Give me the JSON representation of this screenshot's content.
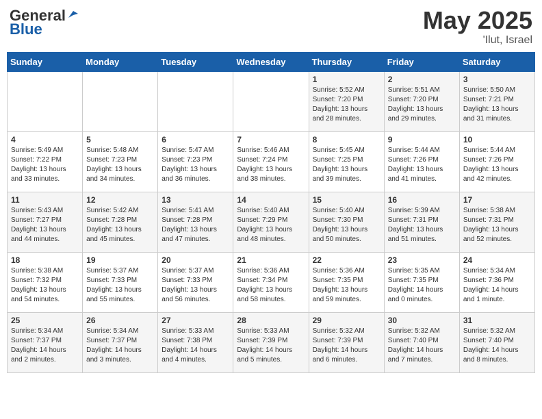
{
  "header": {
    "logo_general": "General",
    "logo_blue": "Blue",
    "month_year": "May 2025",
    "location": "'Ilut, Israel"
  },
  "days_of_week": [
    "Sunday",
    "Monday",
    "Tuesday",
    "Wednesday",
    "Thursday",
    "Friday",
    "Saturday"
  ],
  "weeks": [
    [
      {
        "day": "",
        "info": ""
      },
      {
        "day": "",
        "info": ""
      },
      {
        "day": "",
        "info": ""
      },
      {
        "day": "",
        "info": ""
      },
      {
        "day": "1",
        "info": "Sunrise: 5:52 AM\nSunset: 7:20 PM\nDaylight: 13 hours\nand 28 minutes."
      },
      {
        "day": "2",
        "info": "Sunrise: 5:51 AM\nSunset: 7:20 PM\nDaylight: 13 hours\nand 29 minutes."
      },
      {
        "day": "3",
        "info": "Sunrise: 5:50 AM\nSunset: 7:21 PM\nDaylight: 13 hours\nand 31 minutes."
      }
    ],
    [
      {
        "day": "4",
        "info": "Sunrise: 5:49 AM\nSunset: 7:22 PM\nDaylight: 13 hours\nand 33 minutes."
      },
      {
        "day": "5",
        "info": "Sunrise: 5:48 AM\nSunset: 7:23 PM\nDaylight: 13 hours\nand 34 minutes."
      },
      {
        "day": "6",
        "info": "Sunrise: 5:47 AM\nSunset: 7:23 PM\nDaylight: 13 hours\nand 36 minutes."
      },
      {
        "day": "7",
        "info": "Sunrise: 5:46 AM\nSunset: 7:24 PM\nDaylight: 13 hours\nand 38 minutes."
      },
      {
        "day": "8",
        "info": "Sunrise: 5:45 AM\nSunset: 7:25 PM\nDaylight: 13 hours\nand 39 minutes."
      },
      {
        "day": "9",
        "info": "Sunrise: 5:44 AM\nSunset: 7:26 PM\nDaylight: 13 hours\nand 41 minutes."
      },
      {
        "day": "10",
        "info": "Sunrise: 5:44 AM\nSunset: 7:26 PM\nDaylight: 13 hours\nand 42 minutes."
      }
    ],
    [
      {
        "day": "11",
        "info": "Sunrise: 5:43 AM\nSunset: 7:27 PM\nDaylight: 13 hours\nand 44 minutes."
      },
      {
        "day": "12",
        "info": "Sunrise: 5:42 AM\nSunset: 7:28 PM\nDaylight: 13 hours\nand 45 minutes."
      },
      {
        "day": "13",
        "info": "Sunrise: 5:41 AM\nSunset: 7:28 PM\nDaylight: 13 hours\nand 47 minutes."
      },
      {
        "day": "14",
        "info": "Sunrise: 5:40 AM\nSunset: 7:29 PM\nDaylight: 13 hours\nand 48 minutes."
      },
      {
        "day": "15",
        "info": "Sunrise: 5:40 AM\nSunset: 7:30 PM\nDaylight: 13 hours\nand 50 minutes."
      },
      {
        "day": "16",
        "info": "Sunrise: 5:39 AM\nSunset: 7:31 PM\nDaylight: 13 hours\nand 51 minutes."
      },
      {
        "day": "17",
        "info": "Sunrise: 5:38 AM\nSunset: 7:31 PM\nDaylight: 13 hours\nand 52 minutes."
      }
    ],
    [
      {
        "day": "18",
        "info": "Sunrise: 5:38 AM\nSunset: 7:32 PM\nDaylight: 13 hours\nand 54 minutes."
      },
      {
        "day": "19",
        "info": "Sunrise: 5:37 AM\nSunset: 7:33 PM\nDaylight: 13 hours\nand 55 minutes."
      },
      {
        "day": "20",
        "info": "Sunrise: 5:37 AM\nSunset: 7:33 PM\nDaylight: 13 hours\nand 56 minutes."
      },
      {
        "day": "21",
        "info": "Sunrise: 5:36 AM\nSunset: 7:34 PM\nDaylight: 13 hours\nand 58 minutes."
      },
      {
        "day": "22",
        "info": "Sunrise: 5:36 AM\nSunset: 7:35 PM\nDaylight: 13 hours\nand 59 minutes."
      },
      {
        "day": "23",
        "info": "Sunrise: 5:35 AM\nSunset: 7:35 PM\nDaylight: 14 hours\nand 0 minutes."
      },
      {
        "day": "24",
        "info": "Sunrise: 5:34 AM\nSunset: 7:36 PM\nDaylight: 14 hours\nand 1 minute."
      }
    ],
    [
      {
        "day": "25",
        "info": "Sunrise: 5:34 AM\nSunset: 7:37 PM\nDaylight: 14 hours\nand 2 minutes."
      },
      {
        "day": "26",
        "info": "Sunrise: 5:34 AM\nSunset: 7:37 PM\nDaylight: 14 hours\nand 3 minutes."
      },
      {
        "day": "27",
        "info": "Sunrise: 5:33 AM\nSunset: 7:38 PM\nDaylight: 14 hours\nand 4 minutes."
      },
      {
        "day": "28",
        "info": "Sunrise: 5:33 AM\nSunset: 7:39 PM\nDaylight: 14 hours\nand 5 minutes."
      },
      {
        "day": "29",
        "info": "Sunrise: 5:32 AM\nSunset: 7:39 PM\nDaylight: 14 hours\nand 6 minutes."
      },
      {
        "day": "30",
        "info": "Sunrise: 5:32 AM\nSunset: 7:40 PM\nDaylight: 14 hours\nand 7 minutes."
      },
      {
        "day": "31",
        "info": "Sunrise: 5:32 AM\nSunset: 7:40 PM\nDaylight: 14 hours\nand 8 minutes."
      }
    ]
  ]
}
